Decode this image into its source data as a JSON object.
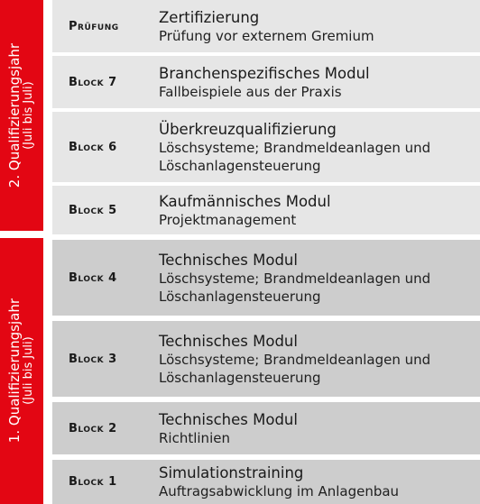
{
  "colors": {
    "accent_red": "#e30613",
    "row_light": "#e6e6e6",
    "row_dark": "#cdcdcd"
  },
  "phases": [
    {
      "title": "2. Qualifizierungsjahr",
      "subtitle": "(Juli bis Juli)"
    },
    {
      "title": "1. Qualifizierungsjahr",
      "subtitle": "(Juli bis Juli)"
    }
  ],
  "rows": [
    {
      "label": "Prüfung",
      "title": "Zertifizierung",
      "desc": "Prüfung vor externem Gremium"
    },
    {
      "label": "Block 7",
      "title": "Branchenspezifisches Modul",
      "desc": "Fallbeispiele aus der Praxis"
    },
    {
      "label": "Block 6",
      "title": "Überkreuzqualifizierung",
      "desc": "Löschsysteme; Brandmeldeanlagen und Löschanlagensteuerung"
    },
    {
      "label": "Block 5",
      "title": "Kaufmännisches Modul",
      "desc": "Projektmanagement"
    },
    {
      "label": "Block 4",
      "title": "Technisches Modul",
      "desc": "Löschsysteme; Brandmeldeanlagen und Löschanlagensteuerung"
    },
    {
      "label": "Block 3",
      "title": "Technisches Modul",
      "desc": "Löschsysteme; Brandmeldeanlagen und Löschanlagensteuerung"
    },
    {
      "label": "Block 2",
      "title": "Technisches Modul",
      "desc": "Richtlinien"
    },
    {
      "label": "Block 1",
      "title": "Simulationstraining",
      "desc": "Auftragsabwicklung im Anlagenbau"
    }
  ]
}
